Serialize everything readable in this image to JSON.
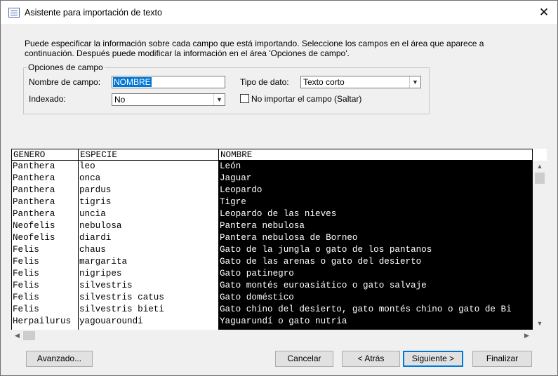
{
  "window": {
    "title": "Asistente para importación de texto",
    "close_glyph": "✕"
  },
  "intro": "Puede especificar la información sobre cada campo que está importando. Seleccione los campos en el área que aparece a continuación. Después puede modificar la información en el área 'Opciones de campo'.",
  "field_options": {
    "legend": "Opciones de campo",
    "field_name_label": "Nombre de campo:",
    "field_name_value": "NOMBRE",
    "data_type_label": "Tipo de dato:",
    "data_type_value": "Texto corto",
    "indexed_label": "Indexado:",
    "indexed_value": "No",
    "skip_label": "No importar el campo (Saltar)",
    "skip_checked": false
  },
  "grid": {
    "columns": [
      "GENERO",
      "ESPECIE",
      "NOMBRE"
    ],
    "selected_column": "NOMBRE",
    "rows": [
      [
        "Panthera",
        "leo",
        "León"
      ],
      [
        "Panthera",
        "onca",
        "Jaguar"
      ],
      [
        "Panthera",
        "pardus",
        "Leopardo"
      ],
      [
        "Panthera",
        "tigris",
        "Tigre"
      ],
      [
        "Panthera",
        "uncia",
        "Leopardo de las nieves"
      ],
      [
        "Neofelis",
        "nebulosa",
        "Pantera nebulosa"
      ],
      [
        "Neofelis",
        "diardi",
        "Pantera nebulosa de Borneo"
      ],
      [
        "Felis",
        "chaus",
        "Gato de la jungla o gato de los pantanos"
      ],
      [
        "Felis",
        "margarita",
        "Gato de las arenas o gato del desierto"
      ],
      [
        "Felis",
        "nigripes",
        "Gato patinegro"
      ],
      [
        "Felis",
        "silvestris",
        "Gato montés euroasiático o gato salvaje"
      ],
      [
        "Felis",
        "silvestris catus",
        "Gato doméstico"
      ],
      [
        "Felis",
        "silvestris bieti",
        "Gato chino del desierto, gato montés chino o gato de Bi"
      ],
      [
        "Herpailurus",
        "yagouaroundi",
        "Yaguarundí o gato nutria"
      ]
    ]
  },
  "buttons": {
    "advanced": "Avanzado...",
    "cancel": "Cancelar",
    "back": "< Atrás",
    "next": "Siguiente >",
    "finish": "Finalizar"
  },
  "colors": {
    "selection": "#0078d7",
    "selected_column_bg": "#000000",
    "selected_column_fg": "#ffffff",
    "dialog_bg": "#f0f0f0"
  },
  "icons": {
    "app": "import-wizard-icon",
    "close": "close-icon",
    "dropdown": "chevron-down-icon",
    "scroll_up": "scroll-up-arrow-icon",
    "scroll_down": "scroll-down-arrow-icon",
    "scroll_left": "scroll-left-arrow-icon",
    "scroll_right": "scroll-right-arrow-icon"
  }
}
